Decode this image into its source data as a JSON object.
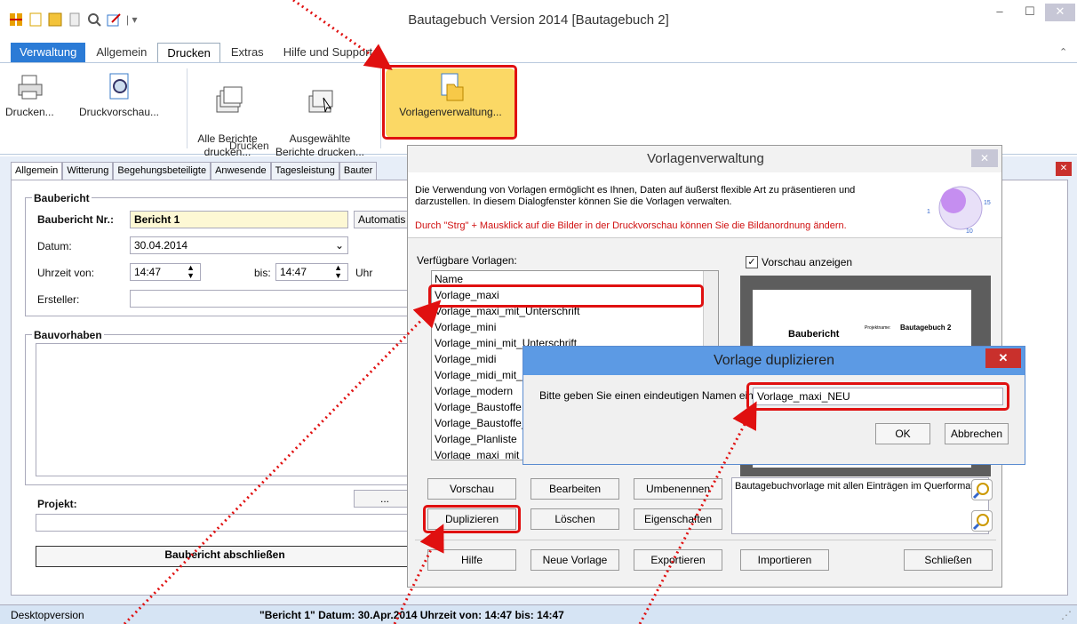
{
  "app": {
    "title": "Bautagebuch Version 2014 [Bautagebuch 2]"
  },
  "tabs": [
    "Verwaltung",
    "Allgemein",
    "Drucken",
    "Extras",
    "Hilfe und Support"
  ],
  "ribbon": {
    "buttons": [
      {
        "label": "Drucken...",
        "icon": "printer-icon"
      },
      {
        "label": "Druckvorschau...",
        "icon": "print-preview-icon"
      },
      {
        "label": "Alle Berichte\ndrucken...",
        "icon": "print-all-icon"
      },
      {
        "label": "Ausgewählte\nBerichte drucken...",
        "icon": "print-selected-icon"
      },
      {
        "label": "Vorlagenverwaltung...",
        "icon": "template-manager-icon"
      }
    ],
    "group_label": "Drucken"
  },
  "inner_tabs": [
    "Allgemein",
    "Witterung",
    "Begehungsbeteiligte",
    "Anwesende",
    "Tagesleistung",
    "Bauter"
  ],
  "form": {
    "section_bericht": "Baubericht",
    "nr_label": "Baubericht Nr.:",
    "nr_value": "Bericht 1",
    "auto_button": "Automatis",
    "datum_label": "Datum:",
    "datum_value": "30.04.2014",
    "uhrzeit_label": "Uhrzeit von:",
    "uhrzeit_von": "14:47",
    "bis_label": "bis:",
    "uhrzeit_bis": "14:47",
    "uhr_label": "Uhr",
    "ersteller_label": "Ersteller:",
    "section_bauvorhaben": "Bauvorhaben",
    "ellipsis": "...",
    "projekt_label": "Projekt:",
    "abschliessen": "Baubericht abschließen"
  },
  "status": {
    "left": "Desktopversion",
    "right": "\"Bericht 1\"  Datum: 30.Apr.2014  Uhrzeit von: 14:47  bis: 14:47"
  },
  "dialog": {
    "title": "Vorlagenverwaltung",
    "info1": "Die Verwendung von Vorlagen ermöglicht es Ihnen, Daten auf äußerst flexible Art zu präsentieren und",
    "info2": "darzustellen. In diesem Dialogfenster können Sie die Vorlagen verwalten.",
    "info_red": "Durch \"Strg\" + Mausklick auf die Bilder in der Druckvorschau können Sie die Bildanordnung ändern.",
    "available_label": "Verfügbare Vorlagen:",
    "list_header": "Name",
    "templates": [
      "Vorlage_maxi",
      "Vorlage_maxi_mit_Unterschrift",
      "Vorlage_mini",
      "Vorlage_mini_mit_Unterschrift",
      "Vorlage_midi",
      "Vorlage_midi_mit_U",
      "Vorlage_modern",
      "Vorlage_Baustoffe",
      "Vorlage_Baustoffe_",
      "Vorlage_Planliste",
      "Vorlage_maxi_mit_"
    ],
    "preview_check": "Vorschau anzeigen",
    "preview_heading": "Baubericht",
    "preview_proj_label": "Projektname:",
    "preview_proj": "Bautagebuch 2",
    "description": "Bautagebuchvorlage mit allen Einträgen im Querformat",
    "buttons": {
      "vorschau": "Vorschau",
      "bearbeiten": "Bearbeiten",
      "umbenennen": "Umbenennen",
      "duplizieren": "Duplizieren",
      "loeschen": "Löschen",
      "eigenschaften": "Eigenschaften",
      "hilfe": "Hilfe",
      "neue": "Neue Vorlage",
      "exportieren": "Exportieren",
      "importieren": "Importieren",
      "schliessen": "Schließen"
    }
  },
  "dup_dialog": {
    "title": "Vorlage duplizieren",
    "prompt": "Bitte geben Sie einen eindeutigen Namen ein:",
    "value": "Vorlage_maxi_NEU",
    "ok": "OK",
    "cancel": "Abbrechen"
  },
  "colors": {
    "accent": "#2b7bd6",
    "highlight": "#fbd865",
    "annotation": "#e01010"
  }
}
